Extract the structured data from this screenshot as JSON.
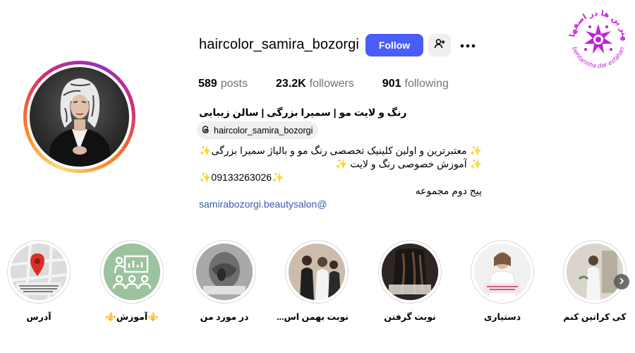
{
  "profile": {
    "username": "haircolor_samira_bozorgi",
    "follow_label": "Follow",
    "stats": [
      {
        "num": "589",
        "label": "posts"
      },
      {
        "num": "23.2K",
        "label": "followers"
      },
      {
        "num": "901",
        "label": "following"
      }
    ],
    "full_name": "رنگ و لایت مو | سمیرا بزرگی | سالن زیبایی تخصصی",
    "threads_handle": "haircolor_samira_bozorgi",
    "bio_lines": [
      "✨ معتبرترین و اولین کلینیک تخصصی رنگ مو و بالیاژ سمیرا بزرگی✨",
      "✨ آموزش خصوصی رنگ و لایت ✨",
      "✨09133263026✨",
      "پیج دوم مجموعه"
    ],
    "bio_link": "samirabozorgi.beautysalon@"
  },
  "highlights": [
    {
      "label": "آدرس",
      "icon": "map-pin-icon"
    },
    {
      "label": "⚜️آموزش⚜️",
      "icon": "presentation-icon"
    },
    {
      "label": "در مورد من",
      "icon": "photo"
    },
    {
      "label": "نوبت بهمن اس...",
      "icon": "photo"
    },
    {
      "label": "نوبت گرفتن",
      "icon": "photo"
    },
    {
      "label": "دستیاری",
      "icon": "photo"
    },
    {
      "label": "کی کراتین کنم",
      "icon": "photo"
    }
  ],
  "colors": {
    "follow_button": "#4a5df9",
    "link": "#3b5ba8",
    "watermark": "#c21fd8"
  },
  "watermark": {
    "top_text": "بهتر ین ها در اصفهان",
    "bottom_text": "behtarinha dar esfahan"
  }
}
